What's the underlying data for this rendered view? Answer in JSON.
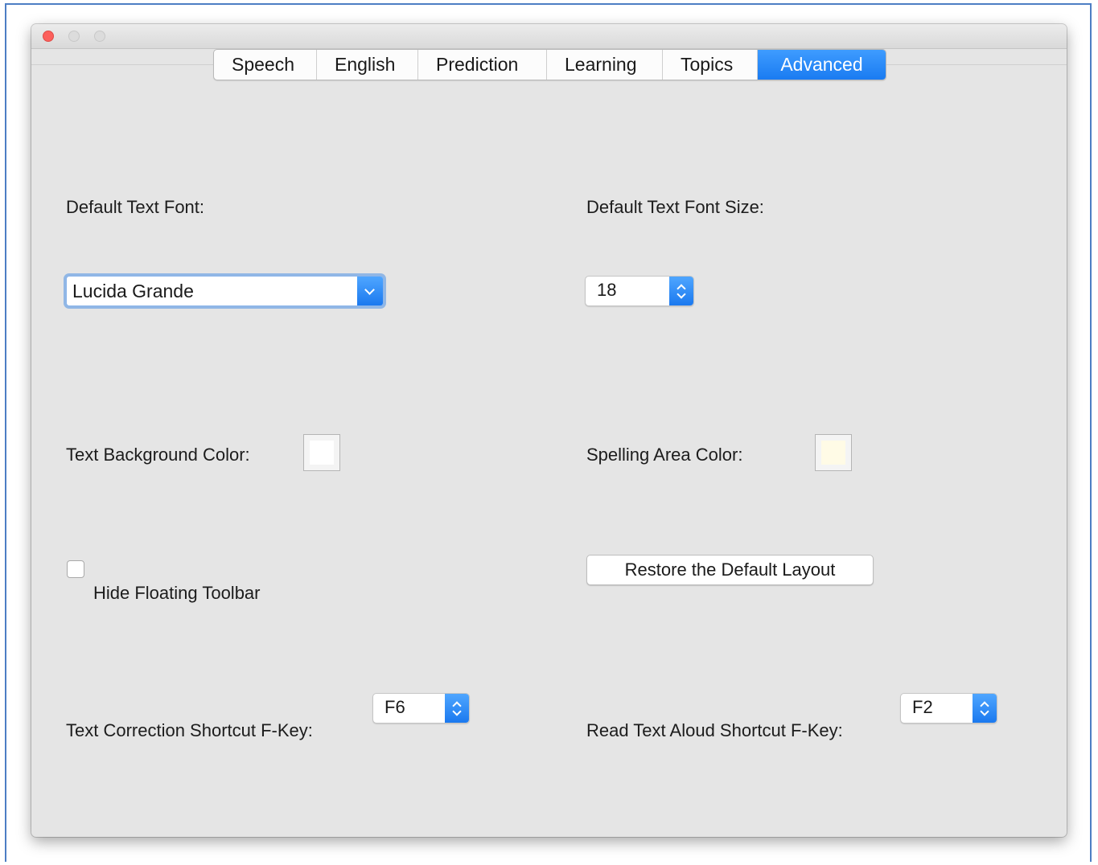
{
  "window": {
    "traffic_lights": [
      "close",
      "minimize",
      "maximize"
    ]
  },
  "tabs": [
    {
      "label": "Speech",
      "active": false
    },
    {
      "label": "English",
      "active": false
    },
    {
      "label": "Prediction",
      "active": false
    },
    {
      "label": "Learning",
      "active": false
    },
    {
      "label": "Topics",
      "active": false
    },
    {
      "label": "Advanced",
      "active": true
    }
  ],
  "advanced": {
    "default_font": {
      "label": "Default Text Font:",
      "value": "Lucida Grande"
    },
    "default_font_size": {
      "label": "Default Text Font Size:",
      "value": "18"
    },
    "text_background_color": {
      "label": "Text Background Color:",
      "color": "#ffffff"
    },
    "spelling_area_color": {
      "label": "Spelling Area Color:",
      "color": "#fffbe6"
    },
    "hide_floating_toolbar": {
      "label": "Hide Floating Toolbar",
      "checked": false
    },
    "restore_layout_button": "Restore the Default Layout",
    "text_correction_shortcut": {
      "label": "Text Correction Shortcut F-Key:",
      "value": "F6"
    },
    "read_aloud_shortcut": {
      "label": "Read Text Aloud Shortcut F-Key:",
      "value": "F2"
    }
  },
  "colors": {
    "accent": "#1a7bf1",
    "window_bg": "#e5e5e5",
    "frame_border": "#4d7ec4"
  }
}
